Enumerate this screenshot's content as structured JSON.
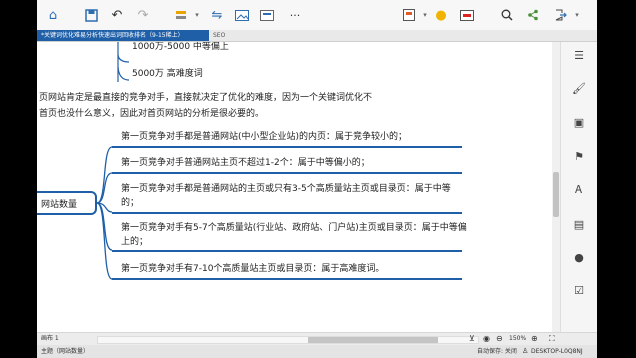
{
  "toolbar": {
    "icons": [
      "home-icon",
      "save-icon",
      "undo-icon",
      "redo-icon",
      "style-icon",
      "link-icon",
      "image-icon",
      "attachment-icon",
      "more-icon",
      "export-icon",
      "tip-icon",
      "insert-icon",
      "search-icon",
      "share-icon",
      "exit-icon"
    ],
    "more_label": "···"
  },
  "tabs": {
    "active": "*关键词优化难易分析快速出词回收排名（9-15稀上）",
    "second": "SEO"
  },
  "top_branches": [
    "1000万-5000 中等偏上",
    "5000万 高难度词"
  ],
  "paragraph": {
    "line1": "页网站肯定是最直接的竞争对手，直接就决定了优化的难度，因为一个关键词优化不",
    "line2": "首页也没什么意义，因此对首页网站的分析是很必要的。"
  },
  "central_topic": "网站数量",
  "branches": [
    {
      "lines": [
        "第一页竞争对手都是普通网站(中小型企业站)的内页：属于竞争较小的；"
      ]
    },
    {
      "lines": [
        "第一页竞争对手普通网站主页不超过1-2个：属于中等偏小的；"
      ]
    },
    {
      "lines": [
        "第一页竞争对手都是普通网站的主页或只有3-5个高质量站主页或目录页：属于中等",
        "的；"
      ]
    },
    {
      "lines": [
        "第一页竞争对手有5-7个高质量站(行业站、政府站、门户站)主页或目录页：属于中等偏",
        "上的；"
      ]
    },
    {
      "lines": [
        "第一页竞争对手有7-10个高质量站主页或目录页：属于高难度词。"
      ]
    }
  ],
  "status": {
    "sheet": "画布 1",
    "zoom": "150%"
  },
  "bottom": {
    "topic": "主题（网站数量）",
    "autosave": "自动保存: 关闭",
    "machine": "DESKTOP-L0Q8NJ"
  },
  "right_panel_icons": [
    "outline-icon",
    "format-icon",
    "image-icon",
    "flag-icon",
    "text-icon",
    "notes-icon",
    "comment-icon",
    "task-icon"
  ]
}
